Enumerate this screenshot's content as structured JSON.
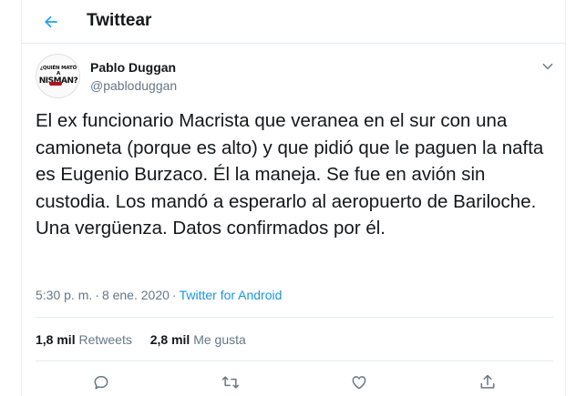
{
  "header": {
    "title": "Twittear",
    "back_icon": "arrow-left-icon",
    "accent": "#1da1f2"
  },
  "tweet": {
    "avatar_text_line1": "¿QUIÉN MATÓ A",
    "avatar_text_line2": "NISMAN?",
    "author_name": "Pablo Duggan",
    "author_handle": "@pabloduggan",
    "text": "El ex funcionario Macrista que veranea en el sur con una camioneta (porque es alto) y que pidió que le paguen la nafta es Eugenio Burzaco. Él la maneja. Se fue en avión sin custodia. Los mandó a esperarlo al aeropuerto de Bariloche. Una vergüenza. Datos confirmados por él.",
    "time": "5:30 p. m.",
    "separator": "·",
    "date": "8 ene. 2020",
    "source": "Twitter for Android"
  },
  "stats": {
    "retweets_count": "1,8 mil",
    "retweets_label": "Retweets",
    "likes_count": "2,8 mil",
    "likes_label": "Me gusta"
  },
  "actions": [
    "reply-icon",
    "retweet-icon",
    "like-icon",
    "share-icon"
  ]
}
